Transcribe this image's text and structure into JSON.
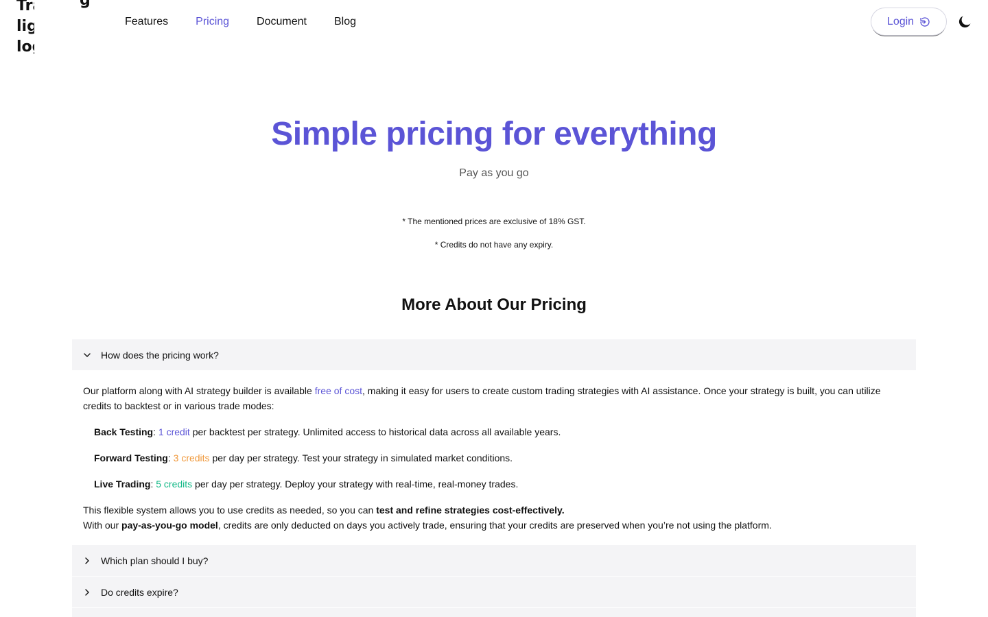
{
  "header": {
    "logo_lines": [
      "Tra",
      "lig",
      "log"
    ],
    "logo_extra": "g",
    "nav": [
      {
        "label": "Features",
        "active": false
      },
      {
        "label": "Pricing",
        "active": true
      },
      {
        "label": "Document",
        "active": false
      },
      {
        "label": "Blog",
        "active": false
      }
    ],
    "login_label": "Login"
  },
  "hero": {
    "title": "Simple pricing for everything",
    "subtitle": "Pay as you go",
    "note_gst": "* The mentioned prices are exclusive of 18% GST.",
    "note_expiry": "* Credits do not have any expiry."
  },
  "faq": {
    "section_title": "More About Our Pricing",
    "items": [
      {
        "question": "How does the pricing work?",
        "expanded": true
      },
      {
        "question": "Which plan should I buy?",
        "expanded": false
      },
      {
        "question": "Do credits expire?",
        "expanded": false
      }
    ],
    "answer": {
      "intro_a": "Our platform along with AI strategy builder is available ",
      "intro_free": "free of cost",
      "intro_b": ", making it easy for users to create custom trading strategies with AI assistance. Once your strategy is built, you can utilize credits to backtest or in various trade modes:",
      "modes": [
        {
          "name": "Back Testing",
          "sep": ": ",
          "credits": "1 credit",
          "color": "#5b54d6",
          "desc": " per backtest per strategy. Unlimited access to historical data across all available years."
        },
        {
          "name": "Forward Testing",
          "sep": ": ",
          "credits": "3 credits",
          "color": "#f0983a",
          "desc": " per day per strategy. Test your strategy in simulated market conditions."
        },
        {
          "name": "Live Trading",
          "sep": ": ",
          "credits": "5 credits",
          "color": "#12b886",
          "desc": " per day per strategy. Deploy your strategy with real-time, real-money trades."
        }
      ],
      "outro_a": "This flexible system allows you to use credits as needed, so you can ",
      "outro_bold": "test and refine strategies cost-effectively.",
      "outro2_a": "With our ",
      "outro2_bold": "pay-as-you-go model",
      "outro2_b": ", credits are only deducted on days you actively trade, ensuring that your credits are preserved when you’re not using the platform."
    }
  },
  "colors": {
    "accent": "#5b54d6",
    "orange": "#f0983a",
    "green": "#12b886"
  }
}
